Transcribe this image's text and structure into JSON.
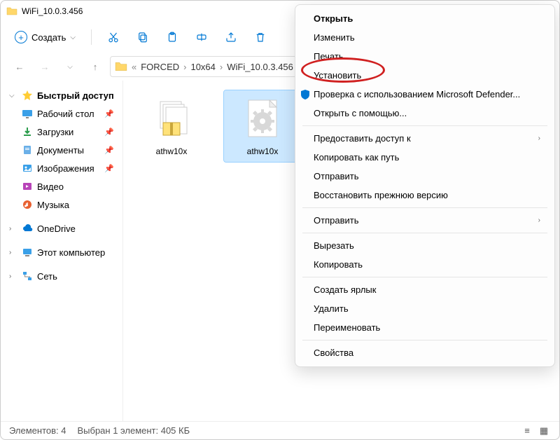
{
  "window_title": "WiFi_10.0.3.456",
  "toolbar": {
    "create_label": "Создать"
  },
  "breadcrumbs": {
    "prefix": "«",
    "items": [
      "FORCED",
      "10x64",
      "WiFi_10.0.3.456"
    ]
  },
  "sidebar": {
    "quick": "Быстрый доступ",
    "desktop": "Рабочий стол",
    "downloads": "Загрузки",
    "documents": "Документы",
    "pictures": "Изображения",
    "video": "Видео",
    "music": "Музыка",
    "onedrive": "OneDrive",
    "thispc": "Этот компьютер",
    "network": "Сеть"
  },
  "files": [
    {
      "name": "athw10x",
      "type": "cab",
      "selected": false
    },
    {
      "name": "athw10x",
      "type": "inf",
      "selected": true
    }
  ],
  "status": {
    "count": "Элементов: 4",
    "selection": "Выбран 1 элемент: 405 КБ"
  },
  "context_menu": {
    "open": "Открыть",
    "edit": "Изменить",
    "print": "Печать",
    "install": "Установить",
    "defender": "Проверка с использованием Microsoft Defender...",
    "open_with": "Открыть с помощью...",
    "share_access": "Предоставить доступ к",
    "copy_path": "Копировать как путь",
    "share": "Отправить",
    "restore": "Восстановить прежнюю версию",
    "send_to": "Отправить",
    "cut": "Вырезать",
    "copy": "Копировать",
    "shortcut": "Создать ярлык",
    "delete": "Удалить",
    "rename": "Переименовать",
    "properties": "Свойства"
  }
}
